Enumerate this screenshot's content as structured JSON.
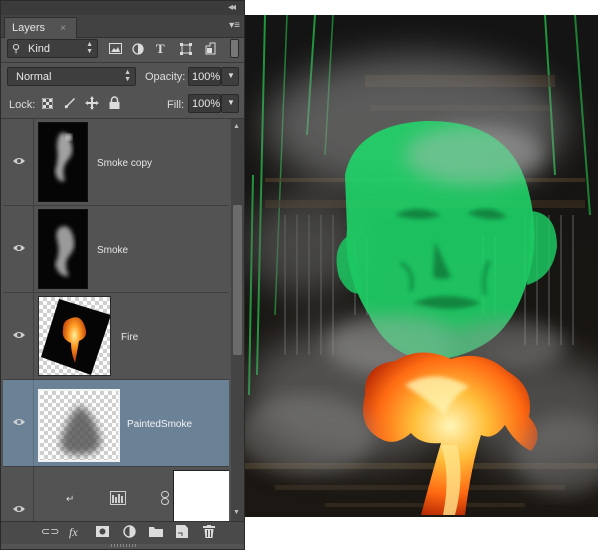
{
  "panel": {
    "tab_label": "Layers",
    "tab_close": "×",
    "collapse_glyph": "◂◂",
    "menu_glyph": "▾≡"
  },
  "filter": {
    "kind_label": "Kind",
    "filter_icons": [
      "image-filter-icon",
      "adjustment-filter-icon",
      "type-filter-icon",
      "shape-filter-icon",
      "smart-object-filter-icon"
    ]
  },
  "blend": {
    "mode": "Normal",
    "opacity_label": "Opacity:",
    "opacity_value": "100%"
  },
  "lock": {
    "label": "Lock:",
    "fill_label": "Fill:",
    "fill_value": "100%"
  },
  "layers": [
    {
      "name": "Smoke copy",
      "visible": true,
      "selected": false
    },
    {
      "name": "Smoke",
      "visible": true,
      "selected": false
    },
    {
      "name": "Fire",
      "visible": true,
      "selected": false
    },
    {
      "name": "PaintedSmoke",
      "visible": true,
      "selected": true
    },
    {
      "name": "",
      "visible": true,
      "selected": false
    }
  ],
  "bottom_icons": [
    "link-layers-icon",
    "fx-icon",
    "add-mask-icon",
    "new-adjustment-icon",
    "new-group-icon",
    "new-layer-icon",
    "delete-layer-icon"
  ],
  "bottom_fx": "fx",
  "colors": {
    "panel_bg": "#535353",
    "selected_row": "#6a8196",
    "face_green": "#1fd86a",
    "fire_orange": "#ff7a1a"
  }
}
